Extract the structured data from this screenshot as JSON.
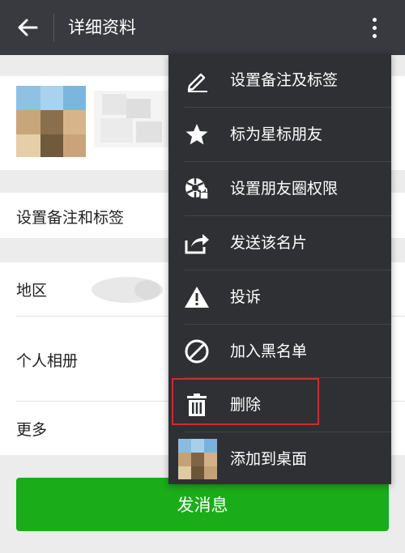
{
  "header": {
    "title": "详细资料"
  },
  "rows": {
    "remark_label": "设置备注和标签",
    "region_label": "地区",
    "album_label": "个人相册",
    "more_label": "更多"
  },
  "send_button": "发消息",
  "menu": {
    "items": [
      {
        "icon": "pencil-icon",
        "label": "设置备注及标签"
      },
      {
        "icon": "star-icon",
        "label": "标为星标朋友"
      },
      {
        "icon": "moments-permission-icon",
        "label": "设置朋友圈权限"
      },
      {
        "icon": "share-icon",
        "label": "发送该名片"
      },
      {
        "icon": "warning-icon",
        "label": "投诉"
      },
      {
        "icon": "block-icon",
        "label": "加入黑名单"
      },
      {
        "icon": "trash-icon",
        "label": "删除"
      },
      {
        "icon": "avatar-thumbnail-icon",
        "label": "添加到桌面"
      }
    ]
  },
  "colors": {
    "header_bg": "#393a3f",
    "menu_bg": "#2f3033",
    "send_green": "#1aad19",
    "highlight_red": "#d42a2a"
  }
}
